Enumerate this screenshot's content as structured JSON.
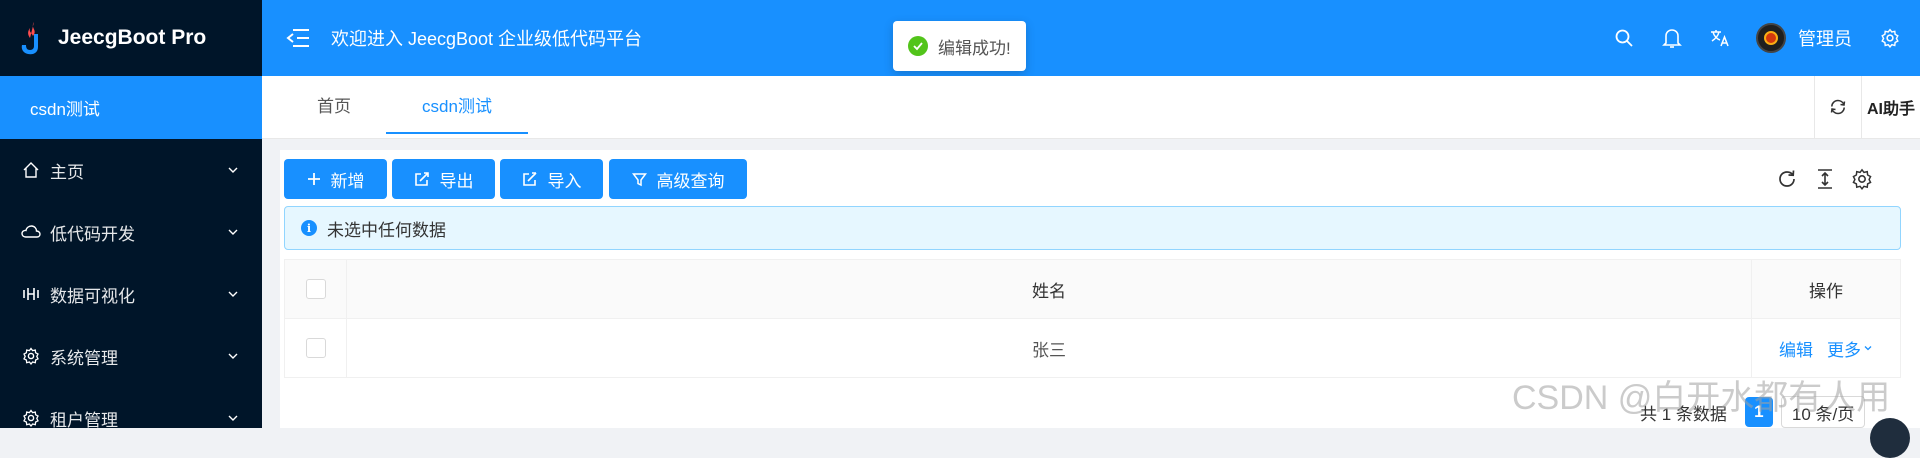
{
  "app": {
    "name": "JeecgBoot Pro"
  },
  "sidebar": {
    "active_item": "csdn测试",
    "items": [
      {
        "label": "主页",
        "icon": "home-icon"
      },
      {
        "label": "低代码开发",
        "icon": "cloud-icon"
      },
      {
        "label": "数据可视化",
        "icon": "chart-icon"
      },
      {
        "label": "系统管理",
        "icon": "gear-icon"
      },
      {
        "label": "租户管理",
        "icon": "gear-icon"
      }
    ]
  },
  "header": {
    "welcome": "欢迎进入 JeecgBoot 企业级低代码平台",
    "user_name": "管理员",
    "icons": [
      "search-icon",
      "bell-icon",
      "translate-icon",
      "settings-icon"
    ]
  },
  "toast": {
    "message": "编辑成功!"
  },
  "tabs": [
    {
      "label": "首页",
      "active": false
    },
    {
      "label": "csdn测试",
      "active": true
    }
  ],
  "tab_tools": {
    "ai_label": "AI助手"
  },
  "toolbar": {
    "add_label": "新增",
    "export_label": "导出",
    "import_label": "导入",
    "query_label": "高级查询"
  },
  "alert": {
    "text": "未选中任何数据"
  },
  "table": {
    "columns": [
      "姓名",
      "操作"
    ],
    "rows": [
      {
        "name": "张三",
        "edit": "编辑",
        "more": "更多"
      }
    ]
  },
  "pagination": {
    "total_text": "共 1 条数据",
    "current_page": "1",
    "page_size": "10 条/页"
  },
  "watermark": "CSDN @白开水都有人用",
  "colors": {
    "primary": "#1890ff",
    "sidebar_bg": "#001529",
    "success": "#52c41a",
    "alert_bg": "#e6f7ff"
  }
}
